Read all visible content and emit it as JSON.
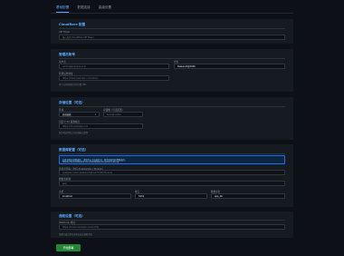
{
  "tabs": [
    "基础配置",
    "数据连接",
    "高级设置"
  ],
  "sections": {
    "cf": {
      "title": "Cloudflare 配置",
      "label": "API Token",
      "placeholder": "输入您的 Cloudflare API Token"
    },
    "admin": {
      "title": "管理员账号",
      "user_label": "用户名",
      "user_value": "admin@example.com",
      "pass_label": "密码",
      "pass_value": "Password@2026",
      "url_label": "管理后台地址",
      "url_value": "https://dash.example.com/admin",
      "url_hint": "用于访问管理后台的完整 URL"
    },
    "optional_a": {
      "title": "存储设置（可选）",
      "region_label": "区域",
      "region_value": "自动选择",
      "bucket_label": "存储桶（可选配置）",
      "bucket_placeholder": "bucket-name",
      "endpoint_label": "自定义 S3 兼容端点",
      "endpoint_placeholder": "https://s3.example.com",
      "endpoint_hint": "留空将使用默认的存储端点配置"
    },
    "optional_b": {
      "title": "数据库配置（可选）",
      "notice_1": "如需使用外部数据库，请填写以下连接信息；留空则使用内置数据库。",
      "notice_2": "https://docs.example.com/database/connection-string",
      "conn_label": "连接字符串（支持 PostgreSQL / MySQL）",
      "conn_placeholder": "postgres://user:password@host:5432/dbname",
      "prefix_label": "数据表前缀",
      "prefix_placeholder": "app_",
      "host_label": "主机",
      "host_value": "localhost",
      "port_label": "端口",
      "port_value": "5432",
      "name_label": "数据库名",
      "name_value": "app_db"
    },
    "optional_c": {
      "title": "通知设置（可选）",
      "webhook_label": "Webhook 地址",
      "webhook_placeholder": "https://hooks.example.com/notify",
      "webhook_hint": "部署完成后将向该地址发送通知消息"
    }
  },
  "submit_label": "开始部署"
}
